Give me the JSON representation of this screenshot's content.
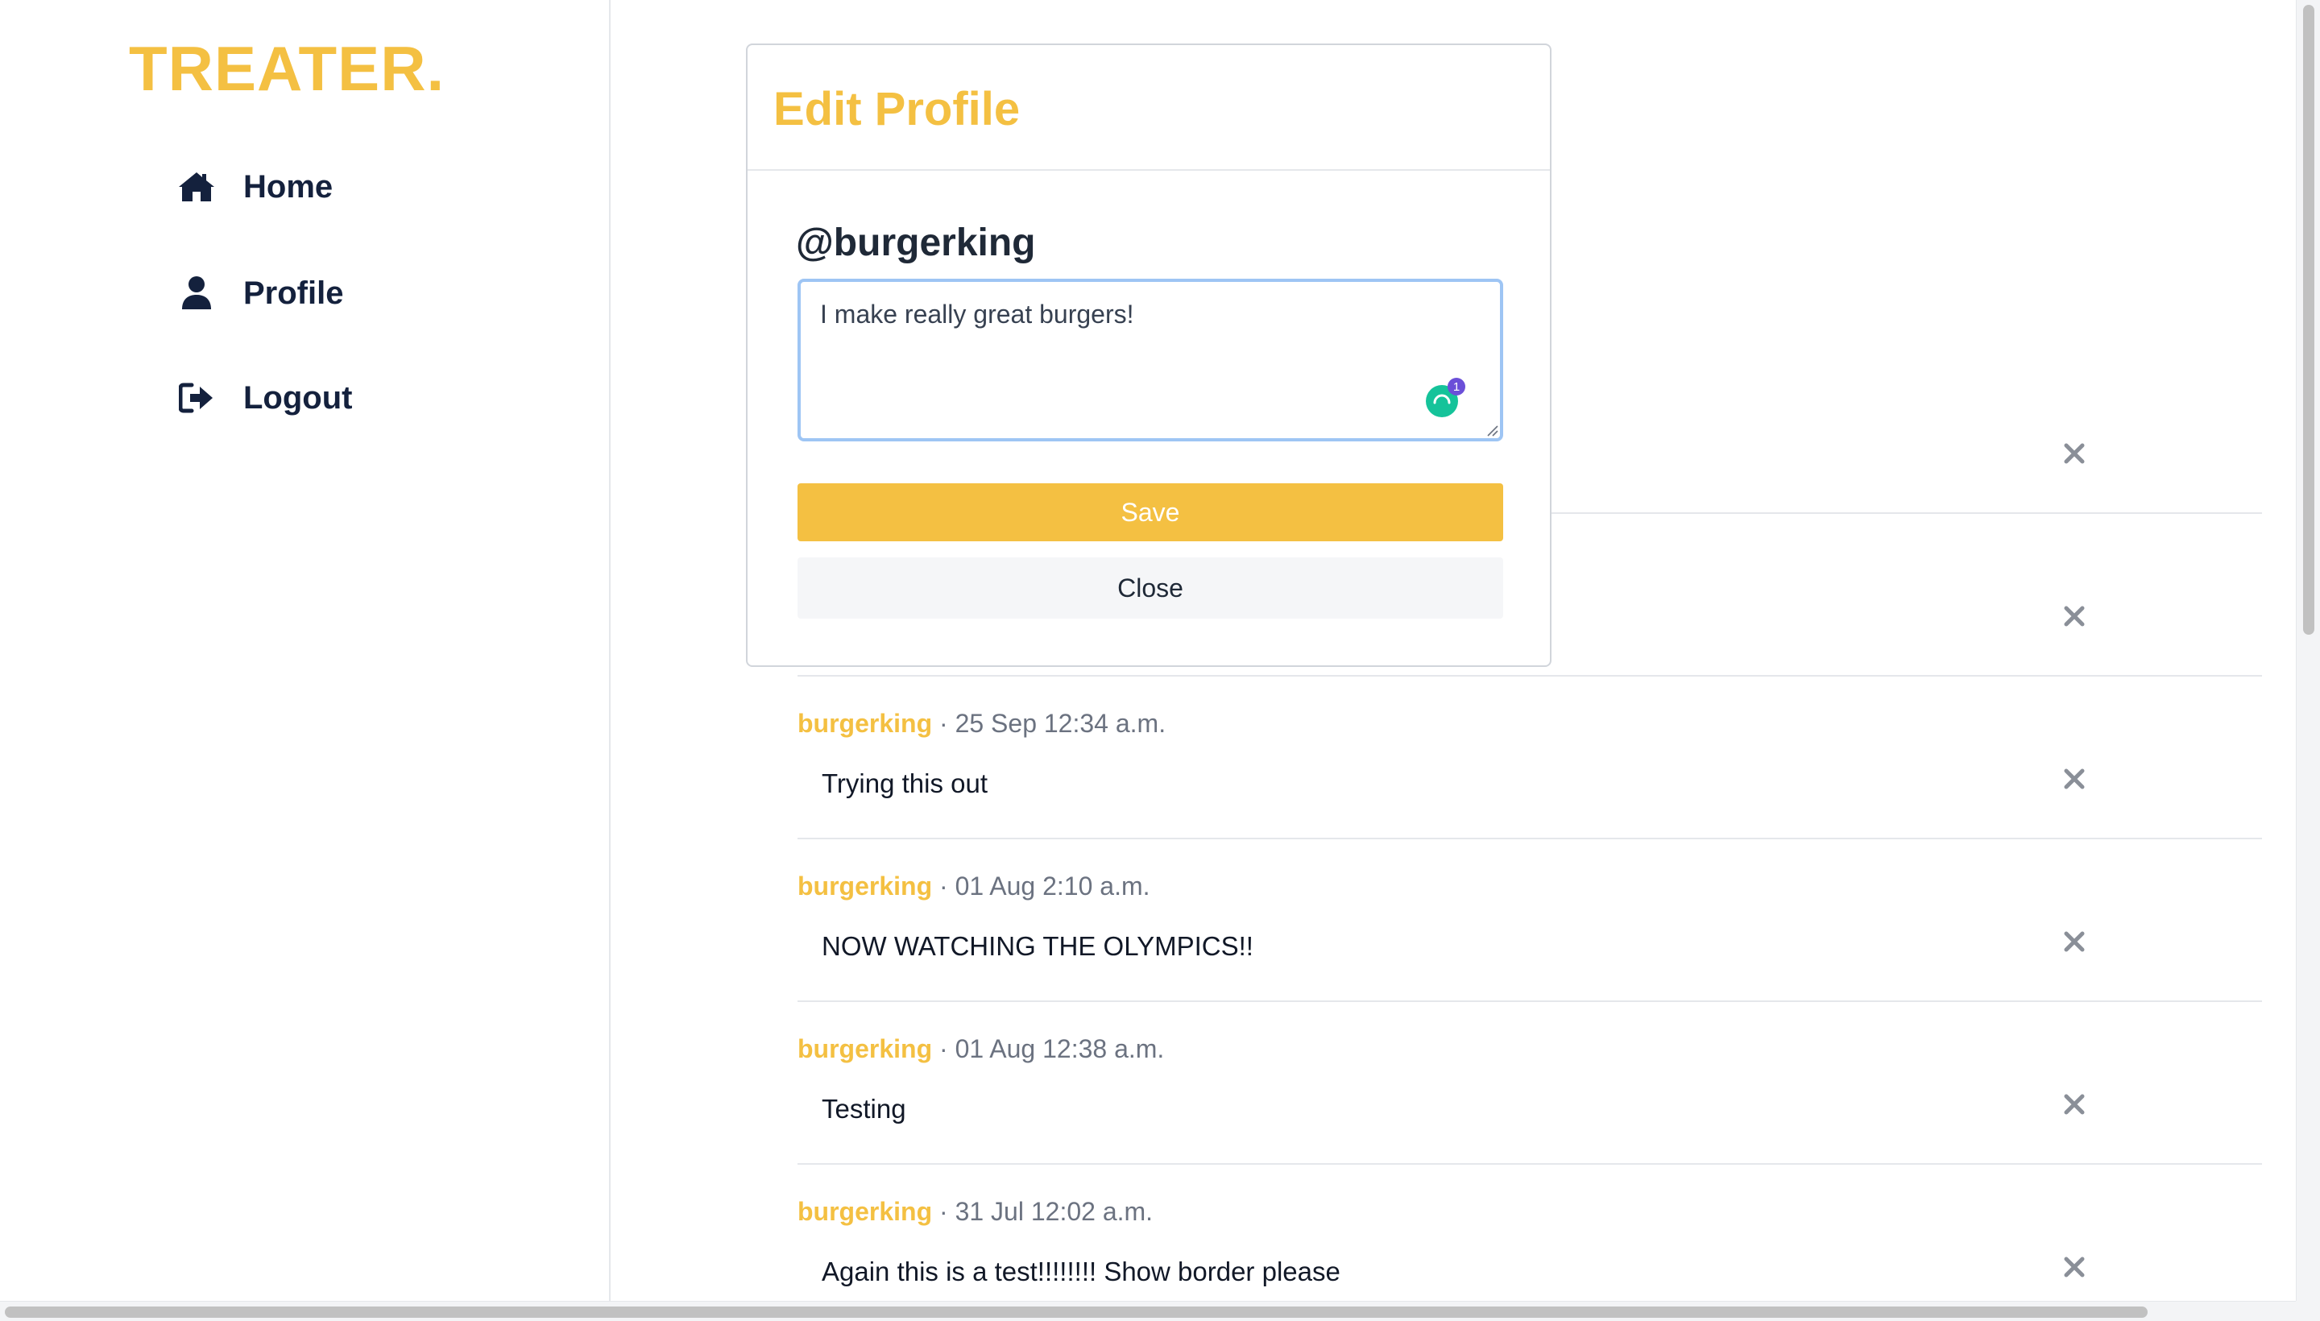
{
  "app": {
    "logo": "TREATER."
  },
  "sidebar": {
    "items": [
      {
        "label": "Home",
        "icon": "home-icon"
      },
      {
        "label": "Profile",
        "icon": "user-icon"
      },
      {
        "label": "Logout",
        "icon": "sign-out-icon"
      }
    ]
  },
  "feed": {
    "posts": [
      {
        "author": "",
        "date": "",
        "text": ""
      },
      {
        "author": "",
        "date": "",
        "text": ""
      },
      {
        "author": "burgerking",
        "date": " · 25 Sep 12:34 a.m.",
        "text": "Trying this out"
      },
      {
        "author": "burgerking",
        "date": " · 01 Aug 2:10 a.m.",
        "text": "NOW WATCHING THE OLYMPICS!!"
      },
      {
        "author": "burgerking",
        "date": " · 01 Aug 12:38 a.m.",
        "text": "Testing"
      },
      {
        "author": "burgerking",
        "date": " · 31 Jul 12:02 a.m.",
        "text": "Again this is a test!!!!!!!! Show border please"
      }
    ]
  },
  "modal": {
    "title": "Edit Profile",
    "handle": "@burgerking",
    "bio_value": "I make really great burgers!",
    "grammar_badge": "1",
    "save_label": "Save",
    "close_label": "Close"
  },
  "colors": {
    "accent": "#f4c042",
    "nav_text": "#14213d",
    "focus_ring": "#9ec5f4",
    "grammar_icon": "#15c39a",
    "badge": "#6b4fd8"
  }
}
